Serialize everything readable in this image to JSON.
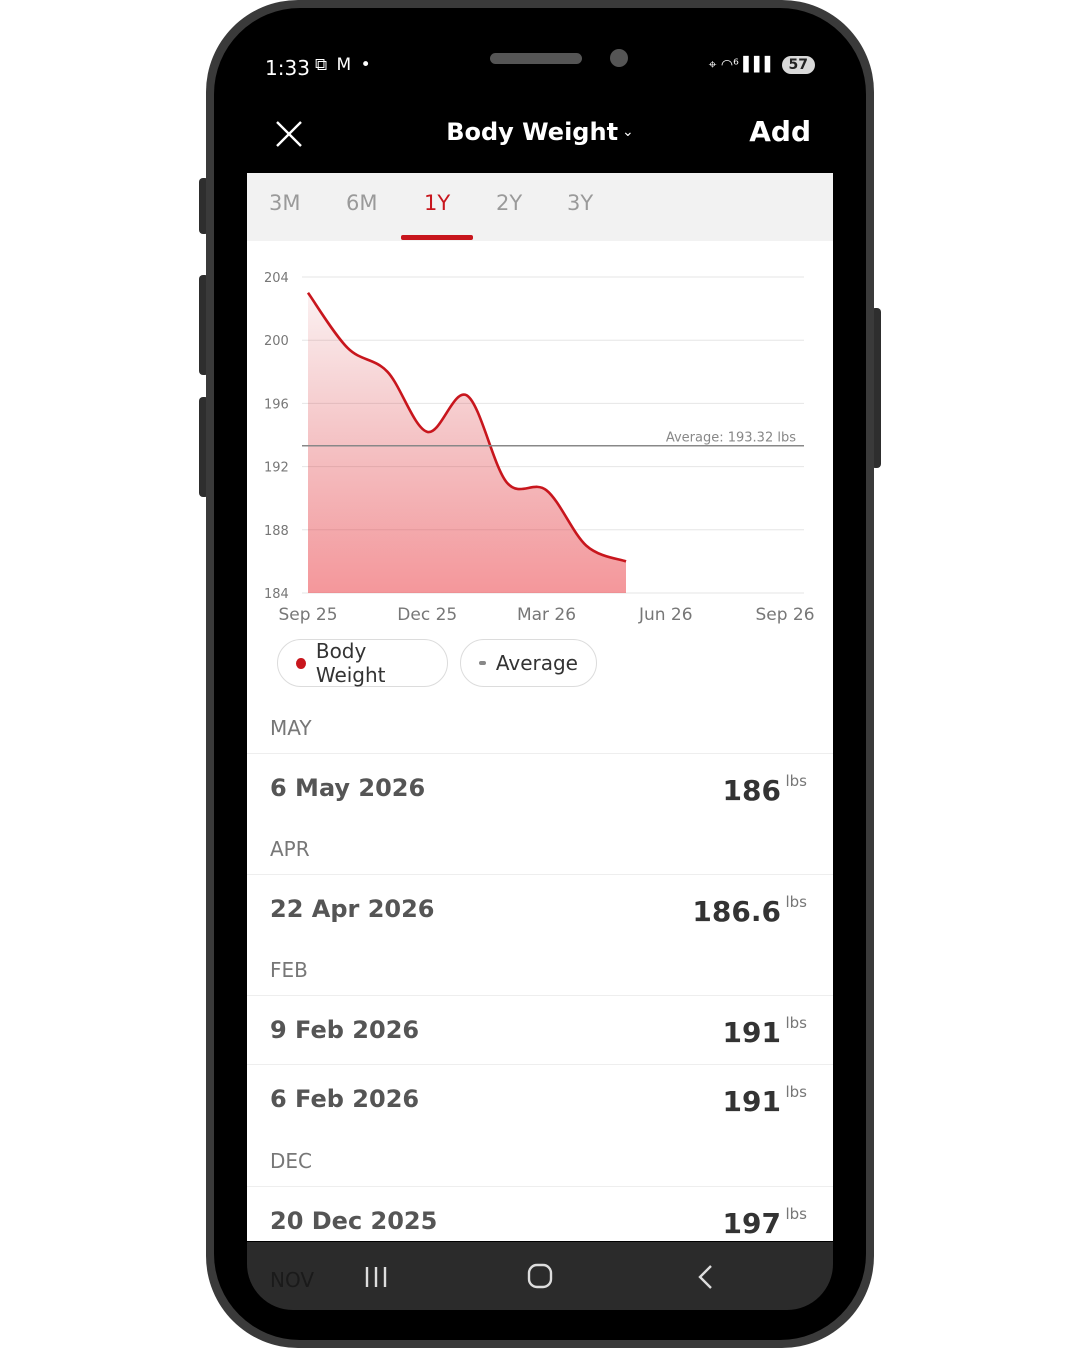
{
  "status_bar": {
    "time": "1:33",
    "left_icons": "⧉ M •",
    "right_icons": "⌖ ◠⁶ ▌▌▌",
    "battery": "57"
  },
  "header": {
    "title": "Body Weight",
    "dropdown_icon": "chevron-down-icon",
    "close_icon": "close-icon",
    "add_label": "Add"
  },
  "tabs": [
    {
      "label": "3M",
      "active": false
    },
    {
      "label": "6M",
      "active": false
    },
    {
      "label": "1Y",
      "active": true
    },
    {
      "label": "2Y",
      "active": false
    },
    {
      "label": "3Y",
      "active": false
    }
  ],
  "chart_data": {
    "type": "area",
    "y_ticks": [
      "204",
      "200",
      "196",
      "192",
      "188",
      "184"
    ],
    "x_ticks": [
      "Sep 25",
      "Dec 25",
      "Mar 26",
      "Jun 26",
      "Sep 26"
    ],
    "ylim": [
      184,
      204
    ],
    "series": [
      {
        "name": "Body Weight",
        "color": "#c8161d",
        "points": [
          {
            "x": "Sep 25",
            "y": 203
          },
          {
            "x": "Oct 25",
            "y": 199.5
          },
          {
            "x": "Nov 25",
            "y": 198
          },
          {
            "x": "Dec 25",
            "y": 194.2
          },
          {
            "x": "Jan 26",
            "y": 196.5
          },
          {
            "x": "Feb 26",
            "y": 191
          },
          {
            "x": "Mar 26",
            "y": 190.5
          },
          {
            "x": "Apr 26",
            "y": 187
          },
          {
            "x": "May 26",
            "y": 186
          }
        ]
      }
    ],
    "average": {
      "value": 193.32,
      "label": "Average: 193.32 lbs",
      "color": "#888888"
    },
    "grid": true
  },
  "legend": [
    {
      "label": "Body Weight"
    },
    {
      "label": "Average"
    }
  ],
  "log": {
    "sections": [
      {
        "month": "MAY",
        "entries": [
          {
            "date": "6 May 2026",
            "value": "186",
            "unit": "lbs"
          }
        ]
      },
      {
        "month": "APR",
        "entries": [
          {
            "date": "22 Apr 2026",
            "value": "186.6",
            "unit": "lbs"
          }
        ]
      },
      {
        "month": "FEB",
        "entries": [
          {
            "date": "9 Feb 2026",
            "value": "191",
            "unit": "lbs"
          },
          {
            "date": "6 Feb 2026",
            "value": "191",
            "unit": "lbs"
          }
        ]
      },
      {
        "month": "DEC",
        "entries": [
          {
            "date": "20 Dec 2025",
            "value": "197",
            "unit": "lbs"
          }
        ]
      },
      {
        "month": "NOV",
        "entries": []
      }
    ]
  },
  "navbar": {
    "recents_icon": "recents-icon",
    "home_icon": "home-icon",
    "back_icon": "back-icon"
  },
  "colors": {
    "accent": "#c8161d",
    "header_bg": "#000000",
    "tabs_bg": "#f2f2f2"
  }
}
